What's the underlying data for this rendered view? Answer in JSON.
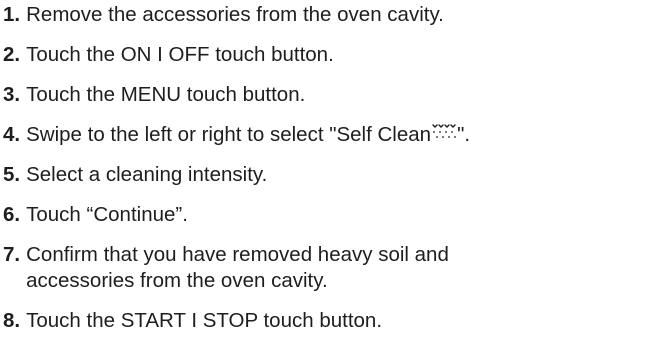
{
  "steps": [
    {
      "number": "1.",
      "text": "Remove the accessories from the oven cavity."
    },
    {
      "number": "2.",
      "text": "Touch the ON I OFF touch button."
    },
    {
      "number": "3.",
      "text": "Touch the MENU touch button."
    },
    {
      "number": "4.",
      "text_before": "Swipe to the left or right to select \"Self Clean",
      "icon": "self-clean-icon",
      "text_after": "\"."
    },
    {
      "number": "5.",
      "text": "Select a cleaning intensity."
    },
    {
      "number": "6.",
      "text": "Touch “Continue”."
    },
    {
      "number": "7.",
      "line1": "Confirm that you have removed heavy soil and",
      "line2": "accessories from the oven cavity."
    },
    {
      "number": "8.",
      "text": "Touch the START I STOP touch button."
    }
  ]
}
